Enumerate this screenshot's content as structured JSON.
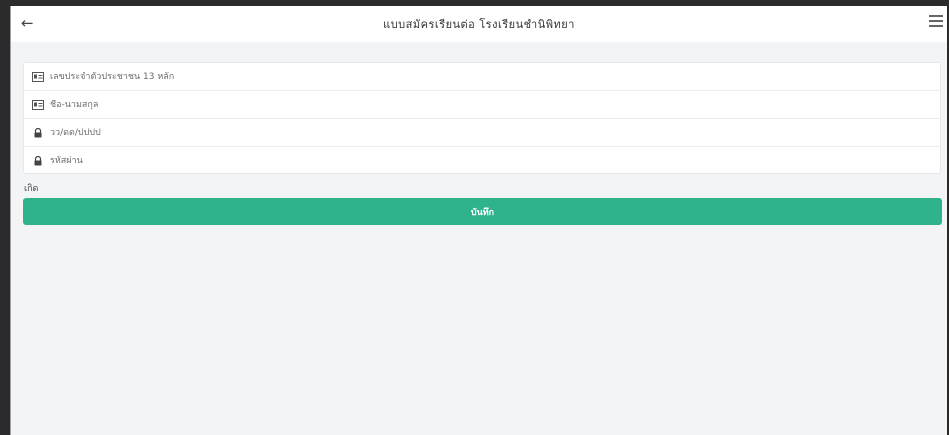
{
  "header": {
    "back_icon": "arrow-left-icon",
    "title": "แบบสมัครเรียนต่อ โรงเรียนชำนิพิทยา",
    "menu_icon": "hamburger-menu-icon"
  },
  "form": {
    "id_card": {
      "icon": "id-card-icon",
      "placeholder": "เลขประจำตัวประชาชน 13 หลัก",
      "value": ""
    },
    "full_name": {
      "icon": "id-card-icon",
      "placeholder": "ชื่อ-นามสกุล",
      "value": ""
    },
    "birthdate": {
      "icon": "lock-icon",
      "placeholder": "วว/ดด/ปปปป",
      "value": ""
    },
    "password": {
      "icon": "lock-icon",
      "placeholder": "รหัสผ่าน",
      "value": ""
    },
    "birth_label": "เกิด"
  },
  "actions": {
    "save_label": "บันทึก"
  },
  "colors": {
    "accent": "#2fb38d",
    "background": "#f3f4f6"
  }
}
